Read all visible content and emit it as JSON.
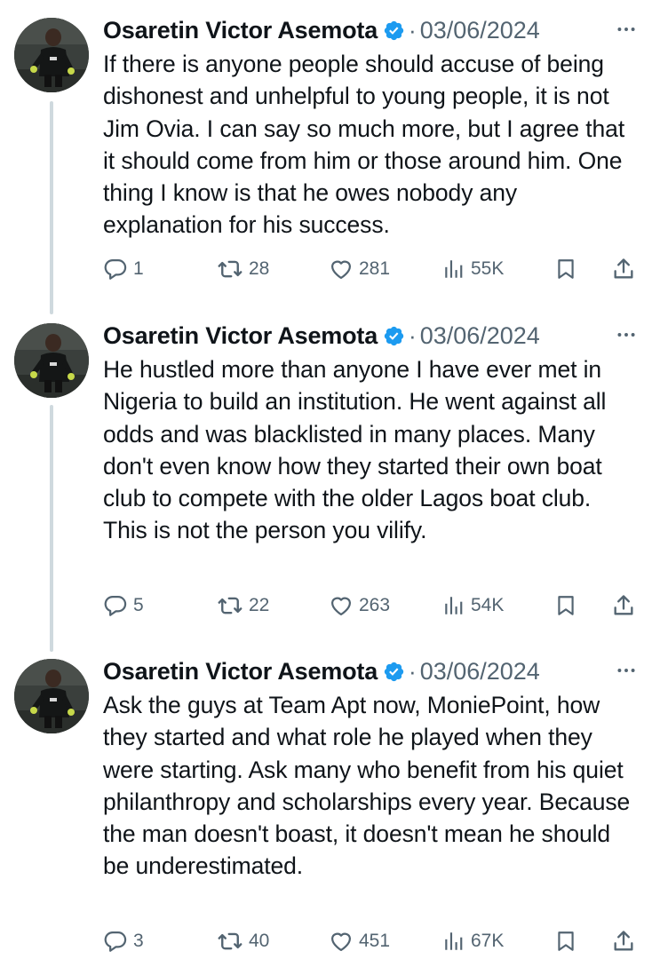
{
  "tweets": [
    {
      "author": "Osaretin Victor Asemota",
      "separator": "·",
      "date": "03/06/2024",
      "text": "If there is anyone people should accuse of being dishonest and unhelpful to young people, it is not Jim Ovia. I can say so much more, but I agree that it should come from him or those around him. One thing I know is that he owes nobody any explanation for his success.",
      "replies": "1",
      "reposts": "28",
      "likes": "281",
      "views": "55K"
    },
    {
      "author": "Osaretin Victor Asemota",
      "separator": "·",
      "date": "03/06/2024",
      "text": "He hustled more than anyone I have ever met in Nigeria to build an institution. He went against all odds and was blacklisted in many places. Many don't even know how they started their own boat club to compete with the older Lagos boat club. This is not the person you vilify.",
      "replies": "5",
      "reposts": "22",
      "likes": "263",
      "views": "54K"
    },
    {
      "author": "Osaretin Victor Asemota",
      "separator": "·",
      "date": "03/06/2024",
      "text": "Ask the guys at Team Apt now, MoniePoint, how they started and what role he played when they were starting. Ask many who benefit from his quiet philanthropy and scholarships every year. Because the man doesn't boast, it doesn't mean he should be underestimated.",
      "replies": "3",
      "reposts": "40",
      "likes": "451",
      "views": "67K"
    }
  ],
  "colors": {
    "accent": "#1d9bf0",
    "muted": "#536471",
    "text": "#0f1419",
    "thread_line": "#cfd9de"
  },
  "icons": [
    "avatar",
    "verified-badge-icon",
    "more-icon",
    "reply-icon",
    "repost-icon",
    "like-icon",
    "views-icon",
    "bookmark-icon",
    "share-icon"
  ]
}
